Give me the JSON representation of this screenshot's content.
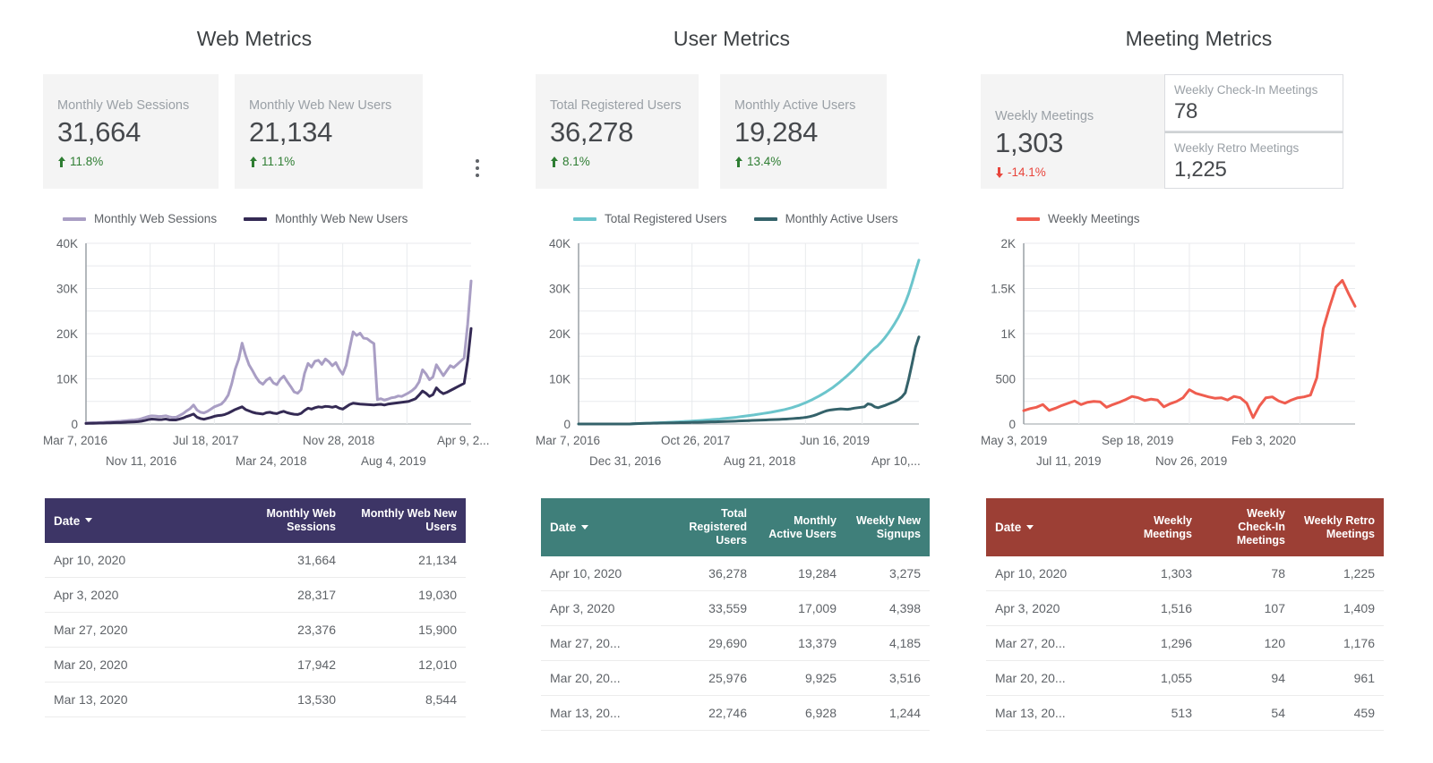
{
  "panels": [
    {
      "title": "Web Metrics",
      "scorecards": [
        {
          "label": "Monthly Web Sessions",
          "value": "31,664",
          "delta": "11.8%",
          "direction": "up"
        },
        {
          "label": "Monthly Web New Users",
          "value": "21,134",
          "delta": "11.1%",
          "direction": "up"
        }
      ],
      "table": {
        "headers": [
          "Date",
          "Monthly Web Sessions",
          "Monthly Web New Users"
        ],
        "header_color": "#3d3566",
        "rows": [
          [
            "Apr 10, 2020",
            "31,664",
            "21,134"
          ],
          [
            "Apr 3, 2020",
            "28,317",
            "19,030"
          ],
          [
            "Mar 27, 2020",
            "23,376",
            "15,900"
          ],
          [
            "Mar 20, 2020",
            "17,942",
            "12,010"
          ],
          [
            "Mar 13, 2020",
            "13,530",
            "8,544"
          ]
        ]
      }
    },
    {
      "title": "User Metrics",
      "scorecards": [
        {
          "label": "Total Registered Users",
          "value": "36,278",
          "delta": "8.1%",
          "direction": "up"
        },
        {
          "label": "Monthly Active Users",
          "value": "19,284",
          "delta": "13.4%",
          "direction": "up"
        }
      ],
      "table": {
        "headers": [
          "Date",
          "Total Registered Users",
          "Monthly Active Users",
          "Weekly New Signups"
        ],
        "header_color": "#3f7f7a",
        "rows": [
          [
            "Apr 10, 2020",
            "36,278",
            "19,284",
            "3,275"
          ],
          [
            "Apr 3, 2020",
            "33,559",
            "17,009",
            "4,398"
          ],
          [
            "Mar 27, 20...",
            "29,690",
            "13,379",
            "4,185"
          ],
          [
            "Mar 20, 20...",
            "25,976",
            "9,925",
            "3,516"
          ],
          [
            "Mar 13, 20...",
            "22,746",
            "6,928",
            "1,244"
          ]
        ]
      }
    },
    {
      "title": "Meeting Metrics",
      "scorecards": [
        {
          "label": "Weekly Meetings",
          "value": "1,303",
          "delta": "-14.1%",
          "direction": "down"
        }
      ],
      "mini_scorecards": [
        {
          "label": "Weekly Check-In Meetings",
          "value": "78"
        },
        {
          "label": "Weekly Retro Meetings",
          "value": "1,225"
        }
      ],
      "table": {
        "headers": [
          "Date",
          "Weekly Meetings",
          "Weekly Check-In Meetings",
          "Weekly Retro Meetings"
        ],
        "header_color": "#9c3f35",
        "rows": [
          [
            "Apr 10, 2020",
            "1,303",
            "78",
            "1,225"
          ],
          [
            "Apr 3, 2020",
            "1,516",
            "107",
            "1,409"
          ],
          [
            "Mar 27, 20...",
            "1,296",
            "120",
            "1,176"
          ],
          [
            "Mar 20, 20...",
            "1,055",
            "94",
            "961"
          ],
          [
            "Mar 13, 20...",
            "513",
            "54",
            "459"
          ]
        ]
      }
    }
  ],
  "chart_data": [
    {
      "type": "line",
      "title": "Web Metrics",
      "xlabel": "",
      "ylabel": "",
      "ylim": [
        0,
        40000
      ],
      "yticks": [
        "0",
        "10K",
        "20K",
        "30K",
        "40K"
      ],
      "xticks_row1": [
        "Mar 7, 2016",
        "Jul 18, 2017",
        "Nov 28, 2018",
        "Apr 9, 2..."
      ],
      "xticks_row2": [
        "Nov 11, 2016",
        "Mar 24, 2018",
        "Aug 4, 2019"
      ],
      "grid": true,
      "legend_position": "top",
      "series": [
        {
          "name": "Monthly Web Sessions",
          "color": "#a99ec4",
          "values": [
            220,
            260,
            300,
            280,
            330,
            360,
            420,
            470,
            520,
            560,
            610,
            700,
            760,
            840,
            900,
            980,
            1180,
            1420,
            1680,
            1810,
            1760,
            1650,
            1700,
            1820,
            1600,
            1450,
            1500,
            1900,
            2300,
            2900,
            3400,
            4200,
            3100,
            2600,
            2450,
            2800,
            3300,
            3800,
            4100,
            4400,
            5200,
            6400,
            8900,
            12100,
            14300,
            17900,
            15200,
            13100,
            11800,
            10400,
            9300,
            8800,
            9700,
            10200,
            9100,
            8700,
            9900,
            10600,
            9400,
            8300,
            7100,
            6800,
            7600,
            11200,
            13400,
            12600,
            13900,
            14100,
            13200,
            14400,
            13800,
            12900,
            13600,
            12100,
            11000,
            13000,
            16800,
            20400,
            19600,
            20100,
            19000,
            18900,
            18300,
            17800,
            5400,
            5600,
            5300,
            5500,
            5800,
            5900,
            6200,
            6100,
            6500,
            6900,
            7400,
            8100,
            9300,
            12000,
            11100,
            9800,
            10400,
            13100,
            11900,
            10700,
            11800,
            12900,
            12500,
            13200,
            13900,
            14600,
            22000,
            31664
          ]
        },
        {
          "name": "Monthly Web New Users",
          "color": "#342a54",
          "values": [
            120,
            150,
            160,
            180,
            200,
            210,
            250,
            260,
            290,
            310,
            330,
            380,
            410,
            450,
            480,
            520,
            620,
            780,
            980,
            1080,
            1050,
            960,
            1000,
            1100,
            920,
            880,
            900,
            1100,
            1320,
            1650,
            1900,
            2200,
            1500,
            1200,
            1050,
            1250,
            1450,
            1700,
            1850,
            1920,
            2100,
            2400,
            2800,
            3200,
            3500,
            3800,
            3200,
            2900,
            2600,
            2400,
            2300,
            2200,
            2500,
            2600,
            2400,
            2300,
            2600,
            2800,
            2500,
            2300,
            2150,
            2100,
            2350,
            3000,
            3500,
            3300,
            3600,
            3800,
            3700,
            3900,
            3850,
            3700,
            3900,
            3500,
            3300,
            3800,
            4300,
            4600,
            4500,
            4400,
            4350,
            4300,
            4250,
            4200,
            4300,
            4350,
            4200,
            4400,
            4500,
            4600,
            4700,
            4800,
            4900,
            5000,
            5300,
            5600,
            6400,
            7300,
            6800,
            6100,
            6500,
            8000,
            7200,
            6700,
            7000,
            7400,
            7800,
            8200,
            8600,
            9000,
            14000,
            21134
          ]
        }
      ]
    },
    {
      "type": "line",
      "title": "User Metrics",
      "xlabel": "",
      "ylabel": "",
      "ylim": [
        0,
        40000
      ],
      "yticks": [
        "0",
        "10K",
        "20K",
        "30K",
        "40K"
      ],
      "xticks_row1": [
        "Mar 7, 2016",
        "Oct 26, 2017",
        "Jun 16, 2019"
      ],
      "xticks_row2": [
        "Dec 31, 2016",
        "Aug 21, 2018",
        "Apr 10,..."
      ],
      "grid": true,
      "legend_position": "top",
      "series": [
        {
          "name": "Total Registered Users",
          "color": "#6cc5cc",
          "values": [
            0,
            0,
            0,
            0,
            0,
            0,
            0,
            0,
            0,
            0,
            0,
            0,
            0,
            0,
            0,
            0,
            60,
            90,
            120,
            150,
            180,
            210,
            240,
            270,
            300,
            330,
            360,
            400,
            440,
            480,
            520,
            560,
            600,
            650,
            700,
            750,
            800,
            860,
            920,
            980,
            1040,
            1100,
            1180,
            1260,
            1340,
            1420,
            1500,
            1600,
            1700,
            1800,
            1900,
            2000,
            2120,
            2240,
            2360,
            2480,
            2600,
            2750,
            2900,
            3050,
            3200,
            3400,
            3600,
            3850,
            4100,
            4400,
            4700,
            5050,
            5400,
            5800,
            6200,
            6650,
            7100,
            7600,
            8100,
            8700,
            9300,
            9950,
            10600,
            11300,
            12000,
            12800,
            13600,
            14400,
            15200,
            16000,
            16700,
            17300,
            18100,
            19000,
            20000,
            21100,
            22300,
            23600,
            25100,
            26800,
            28800,
            31200,
            33800,
            36278
          ]
        },
        {
          "name": "Monthly Active Users",
          "color": "#34626a",
          "values": [
            0,
            0,
            0,
            0,
            0,
            0,
            0,
            0,
            0,
            0,
            0,
            0,
            0,
            0,
            0,
            0,
            55,
            80,
            100,
            120,
            140,
            155,
            170,
            185,
            200,
            215,
            230,
            245,
            260,
            275,
            290,
            305,
            320,
            340,
            360,
            380,
            400,
            420,
            440,
            460,
            480,
            500,
            525,
            550,
            575,
            600,
            630,
            660,
            690,
            720,
            750,
            780,
            810,
            840,
            870,
            900,
            930,
            960,
            990,
            1020,
            1060,
            1100,
            1150,
            1200,
            1260,
            1320,
            1400,
            1500,
            1650,
            1850,
            2100,
            2400,
            2700,
            2950,
            3100,
            3200,
            3280,
            3350,
            3300,
            3250,
            3350,
            3500,
            3600,
            3700,
            3800,
            4450,
            4300,
            3800,
            3600,
            3850,
            4100,
            4400,
            4700,
            5000,
            5400,
            6000,
            6928,
            9925,
            13379,
            17009,
            19284
          ]
        }
      ]
    },
    {
      "type": "line",
      "title": "Meeting Metrics",
      "xlabel": "",
      "ylabel": "",
      "ylim": [
        0,
        2000
      ],
      "yticks": [
        "0",
        "500",
        "1K",
        "1.5K",
        "2K"
      ],
      "xticks_row1": [
        "May 3, 2019",
        "Sep 18, 2019",
        "Feb 3, 2020"
      ],
      "xticks_row2": [
        "Jul 11, 2019",
        "Nov 26, 2019"
      ],
      "grid": true,
      "legend_position": "top",
      "series": [
        {
          "name": "Weekly Meetings",
          "color": "#ef5d4f",
          "values": [
            148,
            170,
            185,
            215,
            150,
            175,
            205,
            230,
            255,
            215,
            240,
            250,
            245,
            185,
            215,
            240,
            270,
            305,
            290,
            260,
            275,
            265,
            190,
            225,
            250,
            290,
            380,
            340,
            320,
            300,
            285,
            290,
            265,
            305,
            290,
            230,
            70,
            200,
            290,
            300,
            255,
            230,
            265,
            290,
            300,
            320,
            513,
            1055,
            1296,
            1516,
            1590,
            1440,
            1303
          ]
        }
      ]
    }
  ]
}
